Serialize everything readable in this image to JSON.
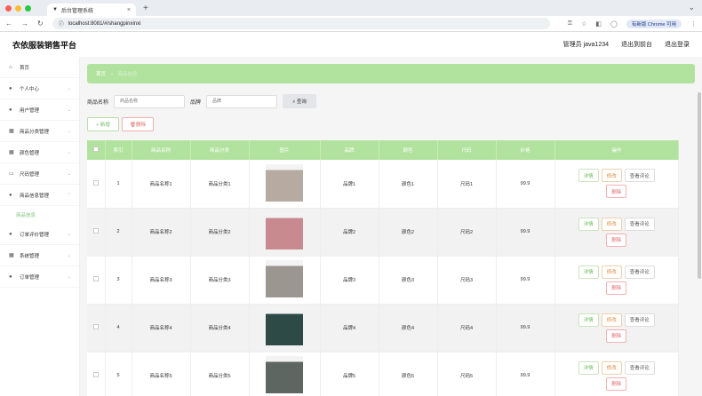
{
  "browser": {
    "tab_title": "后台管理系统",
    "url": "localhost:8081/#/shangpinxinxi",
    "update_label": "有新版 Chrome 可用"
  },
  "header": {
    "title": "衣依服装销售平台",
    "admin": "管理员 java1234",
    "back_front": "退出到前台",
    "logout": "退出登录"
  },
  "sidebar": {
    "items": [
      {
        "label": "首页",
        "icon": "home-icon"
      },
      {
        "label": "个人中心",
        "icon": "user-icon"
      },
      {
        "label": "用户管理",
        "icon": "user-icon"
      },
      {
        "label": "商品分类管理",
        "icon": "grid-icon"
      },
      {
        "label": "颜色管理",
        "icon": "grid-icon"
      },
      {
        "label": "尺码管理",
        "icon": "ruler-icon"
      },
      {
        "label": "商品信息管理",
        "icon": "user-icon"
      },
      {
        "label": "订单评价管理",
        "icon": "user-icon"
      },
      {
        "label": "系统管理",
        "icon": "grid-icon"
      },
      {
        "label": "订单管理",
        "icon": "user-icon"
      }
    ],
    "sub_item": "商品信息"
  },
  "breadcrumb": {
    "home": "首页",
    "current": "商品信息"
  },
  "search": {
    "name_label": "商品名称",
    "name_placeholder": "商品名称",
    "brand_label": "品牌",
    "brand_placeholder": "品牌",
    "query_label": "查询"
  },
  "actions": {
    "add": "新增",
    "delete": "删除"
  },
  "table": {
    "headers": [
      "索引",
      "商品名称",
      "商品分类",
      "图片",
      "品牌",
      "颜色",
      "尺码",
      "价格",
      "操作"
    ],
    "row_ops": {
      "detail": "详情",
      "edit": "修改",
      "review": "查看评论",
      "delete": "删除"
    },
    "rows": [
      {
        "idx": "1",
        "name": "商品名称1",
        "cat": "商品分类1",
        "brand": "品牌1",
        "color": "颜色1",
        "size": "尺码1",
        "price": "99.9"
      },
      {
        "idx": "2",
        "name": "商品名称2",
        "cat": "商品分类2",
        "brand": "品牌2",
        "color": "颜色2",
        "size": "尺码2",
        "price": "99.9"
      },
      {
        "idx": "3",
        "name": "商品名称3",
        "cat": "商品分类3",
        "brand": "品牌3",
        "color": "颜色3",
        "size": "尺码3",
        "price": "99.9"
      },
      {
        "idx": "4",
        "name": "商品名称4",
        "cat": "商品分类4",
        "brand": "品牌4",
        "color": "颜色4",
        "size": "尺码4",
        "price": "99.9"
      },
      {
        "idx": "5",
        "name": "商品名称5",
        "cat": "商品分类5",
        "brand": "品牌5",
        "color": "颜色5",
        "size": "尺码5",
        "price": "99.9"
      }
    ]
  },
  "colors": {
    "accent": "#b1e39e",
    "accent_text": "#6cbb5a"
  }
}
